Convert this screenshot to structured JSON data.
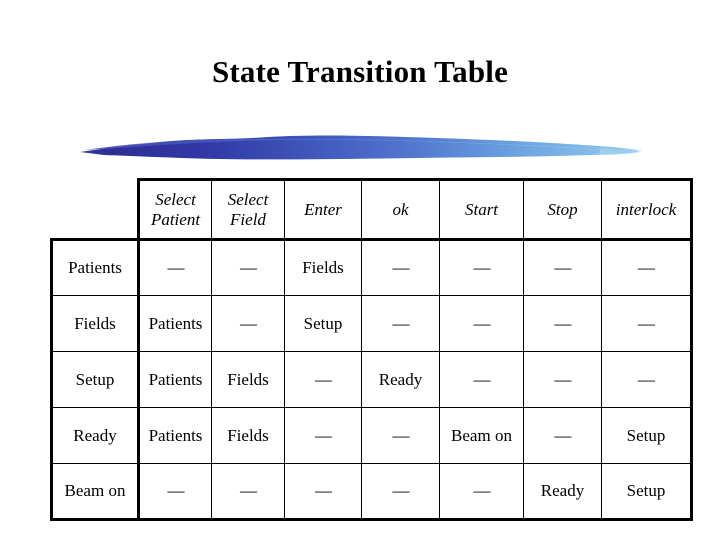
{
  "slide": {
    "title": "State Transition Table",
    "divider": {
      "name": "brush-stroke-divider",
      "color_left": "#2c2f96",
      "color_mid": "#4a6ecd",
      "color_right": "#86bde9"
    }
  },
  "table": {
    "corner_label": "",
    "dash": "—",
    "column_headers": [
      "Select Patient",
      "Select Field",
      "Enter",
      "ok",
      "Start",
      "Stop",
      "interlock"
    ],
    "row_headers": [
      "Patients",
      "Fields",
      "Setup",
      "Ready",
      "Beam on"
    ],
    "rows": [
      {
        "state": "Patients",
        "cells": [
          "—",
          "—",
          "Fields",
          "—",
          "—",
          "—",
          "—"
        ]
      },
      {
        "state": "Fields",
        "cells": [
          "Patients",
          "—",
          "Setup",
          "—",
          "—",
          "—",
          "—"
        ]
      },
      {
        "state": "Setup",
        "cells": [
          "Patients",
          "Fields",
          "—",
          "Ready",
          "—",
          "—",
          "—"
        ]
      },
      {
        "state": "Ready",
        "cells": [
          "Patients",
          "Fields",
          "—",
          "—",
          "Beam on",
          "—",
          "Setup"
        ]
      },
      {
        "state": "Beam on",
        "cells": [
          "—",
          "—",
          "—",
          "—",
          "—",
          "Ready",
          "Setup"
        ]
      }
    ]
  }
}
